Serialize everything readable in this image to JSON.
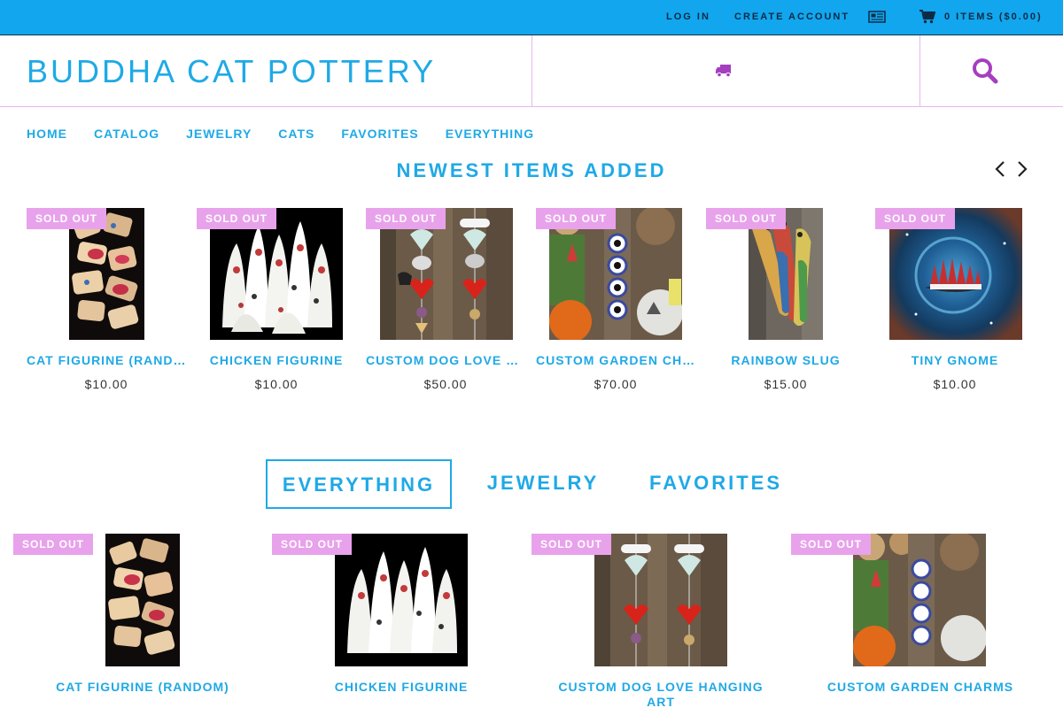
{
  "topbar": {
    "login": "LOG IN",
    "create_account": "CREATE ACCOUNT",
    "news_icon": "newspaper-icon",
    "cart_icon": "shopping-cart-icon",
    "cart_label": "0 ITEMS ($0.00)"
  },
  "header": {
    "logo": "BUDDHA CAT POTTERY",
    "shipping_icon": "truck-icon",
    "search_icon": "search-icon"
  },
  "nav": {
    "items": [
      "HOME",
      "CATALOG",
      "JEWELRY",
      "CATS",
      "FAVORITES",
      "EVERYTHING"
    ]
  },
  "newest": {
    "title": "NEWEST ITEMS ADDED",
    "prev_icon": "chevron-left-icon",
    "next_icon": "chevron-right-icon",
    "items": [
      {
        "badge": "SOLD OUT",
        "name": "CAT FIGURINE (RANDOM)",
        "price": "$10.00"
      },
      {
        "badge": "SOLD OUT",
        "name": "CHICKEN FIGURINE",
        "price": "$10.00"
      },
      {
        "badge": "SOLD OUT",
        "name": "CUSTOM DOG LOVE HANGING ART",
        "price": "$50.00"
      },
      {
        "badge": "SOLD OUT",
        "name": "CUSTOM GARDEN CHARMS",
        "price": "$70.00"
      },
      {
        "badge": "SOLD OUT",
        "name": "RAINBOW SLUG",
        "price": "$15.00"
      },
      {
        "badge": "SOLD OUT",
        "name": "TINY GNOME",
        "price": "$10.00"
      }
    ]
  },
  "tabs": {
    "items": [
      "EVERYTHING",
      "JEWELRY",
      "FAVORITES"
    ],
    "active": "EVERYTHING"
  },
  "grid": {
    "items": [
      {
        "badge": "SOLD OUT",
        "name": "CAT FIGURINE (RANDOM)"
      },
      {
        "badge": "SOLD OUT",
        "name": "CHICKEN FIGURINE"
      },
      {
        "badge": "SOLD OUT",
        "name": "CUSTOM DOG LOVE HANGING ART"
      },
      {
        "badge": "SOLD OUT",
        "name": "CUSTOM GARDEN CHARMS"
      }
    ]
  },
  "colors": {
    "topbar": "#12a6ee",
    "accent": "#1fa9e6",
    "badge": "#e8a2eb",
    "icon_purple": "#a43fbf"
  }
}
